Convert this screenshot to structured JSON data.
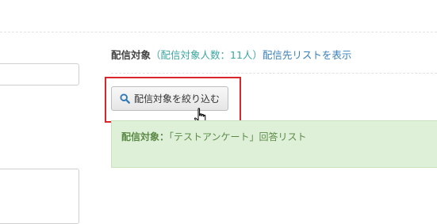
{
  "target_section": {
    "label": "配信対象",
    "count_text": "（配信対象人数：11人）",
    "show_list_link": "配信先リストを表示"
  },
  "filter_button": {
    "icon": "search-icon",
    "label": "配信対象を絞り込む"
  },
  "alert": {
    "label": "配信対象：",
    "value": "「テストアンケート」回答リスト",
    "color": "#dff0d8"
  },
  "highlight_color": "#d9262a"
}
